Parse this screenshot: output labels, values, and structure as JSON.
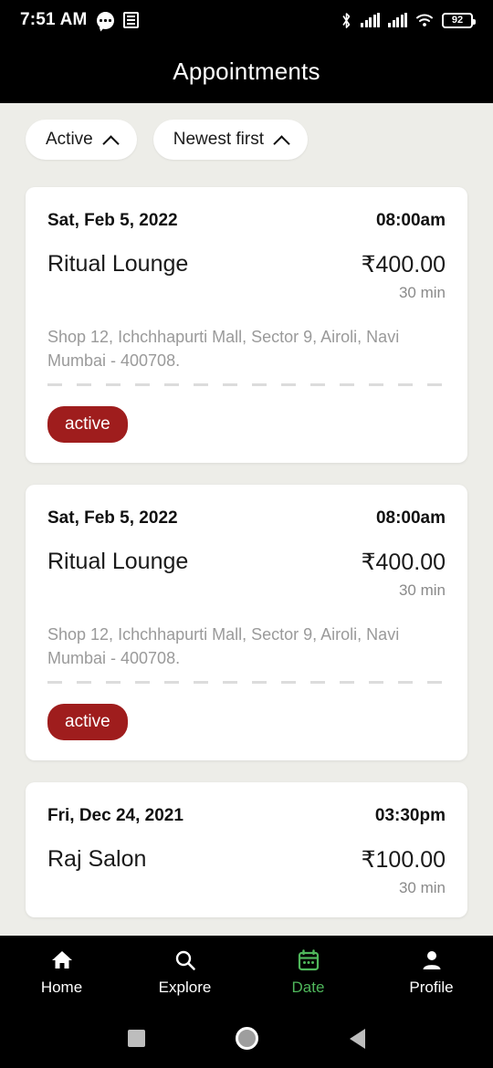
{
  "statusbar": {
    "time": "7:51 AM",
    "icons_left": [
      "chat-bubble-icon",
      "news-list-icon"
    ],
    "icons_right": [
      "bluetooth-icon",
      "signal-bars-icon",
      "signal-bars-2-icon",
      "wifi-icon"
    ],
    "battery_level": "92"
  },
  "header": {
    "title": "Appointments"
  },
  "filters": [
    {
      "label": "Active",
      "icon": "chevron-up-icon"
    },
    {
      "label": "Newest first",
      "icon": "chevron-up-icon"
    }
  ],
  "appointments": [
    {
      "date": "Sat, Feb 5, 2022",
      "time": "08:00am",
      "name": "Ritual Lounge",
      "price": "₹400.00",
      "duration": "30 min",
      "address": "Shop 12, Ichchhapurti Mall, Sector 9, Airoli, Navi Mumbai - 400708.",
      "status": "active"
    },
    {
      "date": "Sat, Feb 5, 2022",
      "time": "08:00am",
      "name": "Ritual Lounge",
      "price": "₹400.00",
      "duration": "30 min",
      "address": "Shop 12, Ichchhapurti Mall, Sector 9, Airoli, Navi Mumbai - 400708.",
      "status": "active"
    },
    {
      "date": "Fri, Dec 24, 2021",
      "time": "03:30pm",
      "name": "Raj Salon",
      "price": "₹100.00",
      "duration": "30 min",
      "address": "",
      "status": ""
    }
  ],
  "bottom_nav": {
    "active": "Date",
    "accent_color": "#4FB75B",
    "items": [
      {
        "label": "Home",
        "icon": "home-icon"
      },
      {
        "label": "Explore",
        "icon": "search-icon"
      },
      {
        "label": "Date",
        "icon": "calendar-icon"
      },
      {
        "label": "Profile",
        "icon": "person-icon"
      }
    ]
  },
  "android_nav": [
    "recents-square-icon",
    "home-circle-icon",
    "back-triangle-icon"
  ],
  "colors": {
    "badge": "#9F1D1D",
    "page_background": "#EDEDE8",
    "card": "#FFFFFF",
    "bar": "#000000"
  }
}
